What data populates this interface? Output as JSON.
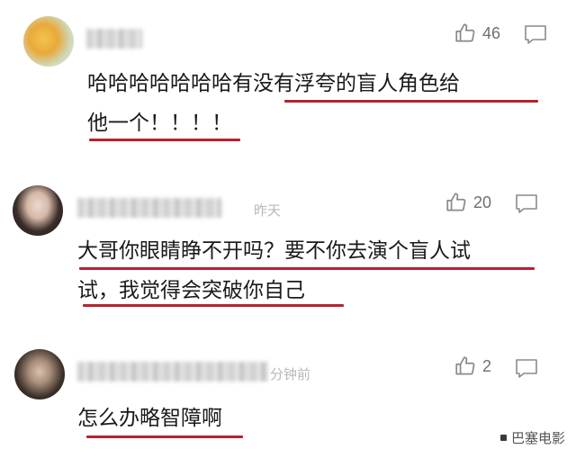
{
  "comments": [
    {
      "likes": "46",
      "lines": [
        "哈哈哈哈哈哈哈有没有浮夸的盲人角色给",
        "他一个！！！！"
      ]
    },
    {
      "likes": "20",
      "name_tail": "昨天",
      "lines": [
        "大哥你眼睛睁不开吗？要不你去演个盲人试",
        "试，我觉得会突破你自己"
      ]
    },
    {
      "likes": "2",
      "name_tail": "分钟前",
      "lines": [
        "怎么办略智障啊"
      ]
    }
  ],
  "watermark": "巴塞电影",
  "colors": {
    "underline": "#b4232d",
    "icon": "#8a8a8a"
  },
  "icons": [
    "thumbs-up-icon",
    "reply-bubble-icon"
  ]
}
